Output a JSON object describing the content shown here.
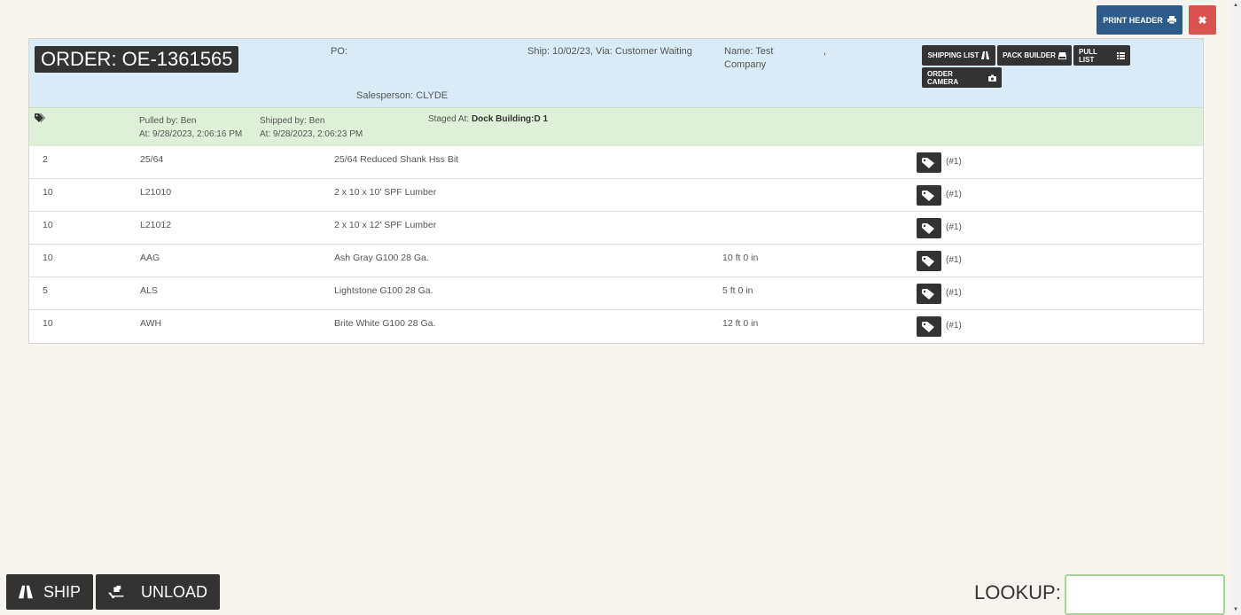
{
  "top_actions": {
    "print_header": "PRINT HEADER",
    "close": "✖"
  },
  "order": {
    "title": "ORDER: OE-1361565",
    "po": "PO:",
    "ship": "Ship: 10/02/23, Via: Customer Waiting",
    "name_line1": "Name: Test",
    "name_line2": "Company",
    "comma": ",",
    "salesperson": "Salesperson: CLYDE",
    "buttons": {
      "shipping_list": "SHIPPING LIST",
      "pack_builder": "PACK BUILDER",
      "pull_list": "PULL LIST",
      "order_camera": "ORDER CAMERA"
    }
  },
  "status": {
    "pulled_by": "Pulled by: Ben",
    "pulled_at": "At: 9/28/2023, 2:06:16 PM",
    "shipped_by": "Shipped by: Ben",
    "shipped_at": "At: 9/28/2023, 2:06:23 PM",
    "staged_label": "Staged At: ",
    "staged_value": "Dock Building:D 1"
  },
  "lines": [
    {
      "qty": "2",
      "item": "25/64",
      "description": "25/64 Reduced Shank Hss Bit",
      "length": "",
      "tag": "(#1)"
    },
    {
      "qty": "10",
      "item": "L21010",
      "description": "2 x 10 x 10' SPF Lumber",
      "length": "",
      "tag": "(#1)"
    },
    {
      "qty": "10",
      "item": "L21012",
      "description": "2 x 10 x 12' SPF Lumber",
      "length": "",
      "tag": "(#1)"
    },
    {
      "qty": "10",
      "item": "AAG",
      "description": "Ash Gray G100 28 Ga.",
      "length": "10 ft 0 in",
      "tag": "(#1)"
    },
    {
      "qty": "5",
      "item": "ALS",
      "description": "Lightstone G100 28 Ga.",
      "length": "5 ft 0 in",
      "tag": "(#1)"
    },
    {
      "qty": "10",
      "item": "AWH",
      "description": "Brite White G100 28 Ga.",
      "length": "12 ft 0 in",
      "tag": "(#1)"
    }
  ],
  "bottom": {
    "ship": "SHIP",
    "unload": "UNLOAD",
    "lookup_label": "LOOKUP:",
    "lookup_value": ""
  }
}
